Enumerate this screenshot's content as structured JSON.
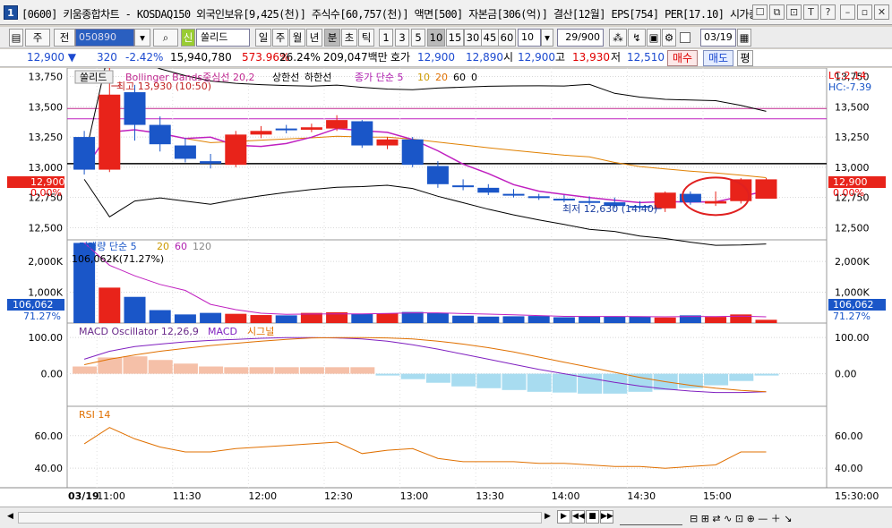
{
  "window": {
    "app_icon_label": "1",
    "title": "[0600] 키움종합차트 - KOSDAQ150 외국인보유[9,425(천)] 주식수[60,757(천)] 액면[500] 자본금[306(억)] 결산[12월] EPS[754] PER[17.10] 시가총",
    "controls": [
      "☐",
      "⧉",
      "⊡",
      "T",
      "?",
      "–",
      "▫",
      "✕"
    ]
  },
  "toolbar": {
    "buttons_left": [
      "주",
      "전"
    ],
    "code_value": "050890",
    "stock_prefix": "신",
    "stock_name": "쏠리드",
    "periods": [
      "일",
      "주",
      "월",
      "년",
      "분",
      "초",
      "틱"
    ],
    "selected_period": "분",
    "intervals": [
      "1",
      "3",
      "5",
      "10",
      "15",
      "30",
      "45",
      "60"
    ],
    "selected_interval": "10",
    "interval_select": "10",
    "count_value": "29/900",
    "date_value": "03/19"
  },
  "quote": {
    "price": "12,900 ▼",
    "change": "320",
    "change_pct": "-2.42%",
    "volume": "15,940,780",
    "volume_ratio": "573.96%",
    "turnover": "26.24%",
    "amount": "209,047백만",
    "hoga_label": "호가",
    "hoga1": "12,900",
    "hoga2": "12,890",
    "open_label": "시",
    "open": "12,900",
    "high_label": "고",
    "high": "13,930",
    "low_label": "저",
    "low": "12,510",
    "buy_button": "매수",
    "sell_button": "매도",
    "eval_button": "평"
  },
  "chart": {
    "price_legend": {
      "stock": "쏠리드",
      "bb": "Bollinger Bands중심선 20,2",
      "bb_upper": "상한선",
      "bb_lower": "하한선",
      "ma": "종가 단순 5",
      "ma10": "10",
      "ma20": "20",
      "ma60": "60",
      "ma0": "0"
    },
    "high_annotation": "최고 13,930 (10:50)",
    "low_annotation": "최저 12,630 (14:40)",
    "lc_label": "LC:2.14",
    "hc_label": "HC:-7.39",
    "current_price_tag": "12,900",
    "current_pct_tag": "0.00%",
    "volume_legend": {
      "label": "거래량 단순 5",
      "v20": "20",
      "v60": "60",
      "v120": "120"
    },
    "volume_info": "106,062K(71.27%)",
    "volume_tag": "106,062",
    "volume_pct_tag": "71.27%",
    "macd_legend": {
      "osc": "MACD Oscillator 12,26,9",
      "macd": "MACD",
      "signal": "시그널"
    },
    "rsi_legend": "RSI 14",
    "date_label": "03/19",
    "right_time": "15:30:00",
    "colors": {
      "up": "#e8231a",
      "down": "#1a56c8",
      "osc_pos": "#f5c0a8",
      "osc_neg": "#a8dcf0"
    }
  },
  "chart_data": [
    {
      "type": "candlestick",
      "x": [
        "10:50",
        "11:00",
        "11:10",
        "11:20",
        "11:30",
        "11:40",
        "11:50",
        "12:00",
        "12:10",
        "12:20",
        "12:30",
        "12:40",
        "12:50",
        "13:00",
        "13:10",
        "13:20",
        "13:30",
        "13:40",
        "13:50",
        "14:00",
        "14:10",
        "14:20",
        "14:30",
        "14:40",
        "14:50",
        "15:00",
        "15:10",
        "15:20"
      ],
      "open": [
        13250,
        12980,
        13620,
        13350,
        13180,
        13050,
        13020,
        13270,
        13320,
        13310,
        13320,
        13380,
        13180,
        13230,
        13010,
        12850,
        12830,
        12780,
        12760,
        12740,
        12720,
        12710,
        12680,
        12660,
        12780,
        12700,
        12720,
        12740
      ],
      "close": [
        12980,
        13600,
        13350,
        13190,
        13070,
        13030,
        13270,
        13300,
        13310,
        13330,
        13390,
        13180,
        13230,
        13020,
        12860,
        12840,
        12790,
        12770,
        12750,
        12730,
        12710,
        12680,
        12670,
        12790,
        12710,
        12720,
        12900,
        12900
      ],
      "high": [
        13300,
        13930,
        13680,
        13420,
        13240,
        13110,
        13300,
        13340,
        13350,
        13360,
        13430,
        13390,
        13250,
        13250,
        13050,
        12900,
        12860,
        12820,
        12780,
        12770,
        12760,
        12750,
        12720,
        12800,
        12800,
        12800,
        12910,
        12910
      ],
      "low": [
        12940,
        12960,
        13220,
        13130,
        13040,
        12990,
        13000,
        13240,
        13280,
        13290,
        13300,
        13160,
        13150,
        13000,
        12830,
        12810,
        12770,
        12750,
        12730,
        12710,
        12690,
        12660,
        12640,
        12630,
        12690,
        12680,
        12700,
        12870
      ],
      "ylim": [
        12400,
        13820
      ]
    },
    {
      "type": "bar",
      "name": "거래량",
      "values": [
        2600,
        1150,
        850,
        420,
        280,
        330,
        300,
        260,
        250,
        330,
        350,
        300,
        320,
        360,
        320,
        240,
        210,
        220,
        230,
        190,
        220,
        210,
        210,
        180,
        250,
        200,
        280,
        106
      ],
      "ylim": [
        0,
        2700
      ]
    },
    {
      "type": "bar",
      "name": "MACD Oscillator 12,26,9",
      "values": [
        20,
        45,
        48,
        38,
        28,
        20,
        18,
        18,
        18,
        18,
        18,
        18,
        -5,
        -15,
        -25,
        -35,
        -40,
        -45,
        -50,
        -52,
        -55,
        -55,
        -50,
        -45,
        -40,
        -32,
        -20,
        -5
      ],
      "ylim": [
        -90,
        140
      ]
    },
    {
      "type": "line",
      "name": "RSI 14",
      "values": [
        55,
        65,
        58,
        53,
        50,
        50,
        52,
        53,
        54,
        55,
        56,
        49,
        51,
        52,
        46,
        44,
        44,
        44,
        43,
        43,
        42,
        41,
        41,
        40,
        41,
        42,
        50,
        50
      ],
      "ylim": [
        28,
        78
      ]
    }
  ]
}
